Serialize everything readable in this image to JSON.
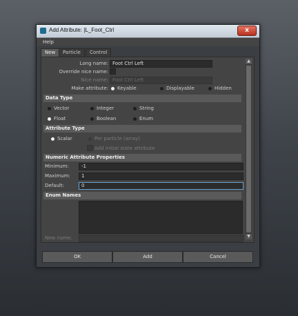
{
  "window": {
    "title": "Add Attribute: |L_Foot_Ctrl",
    "close_label": "x"
  },
  "menu": {
    "help": "Help"
  },
  "tabs": [
    "New",
    "Particle",
    "Control"
  ],
  "form": {
    "long_name_label": "Long name:",
    "long_name_value": "Foot Ctrl Left",
    "override_label": "Override nice name:",
    "nice_name_label": "Nice name:",
    "nice_name_value": "Foot Ctrl Left",
    "make_attribute_label": "Make attribute:",
    "make_attribute_options": [
      "Keyable",
      "Displayable",
      "Hidden"
    ]
  },
  "data_type": {
    "title": "Data Type",
    "options": [
      "Vector",
      "Integer",
      "String",
      "Float",
      "Boolean",
      "Enum"
    ]
  },
  "attribute_type": {
    "title": "Attribute Type",
    "scalar": "Scalar",
    "per_particle": "Per particle (array)",
    "initial_state": "Add initial state attribute"
  },
  "numeric": {
    "title": "Numeric Attribute Properties",
    "minimum_label": "Minimum:",
    "minimum_value": "-1",
    "maximum_label": "Maximum:",
    "maximum_value": "1",
    "default_label": "Default:",
    "default_value": "0"
  },
  "enum": {
    "title": "Enum Names",
    "new_name_label": "New name:"
  },
  "buttons": {
    "ok": "OK",
    "add": "Add",
    "cancel": "Cancel"
  }
}
